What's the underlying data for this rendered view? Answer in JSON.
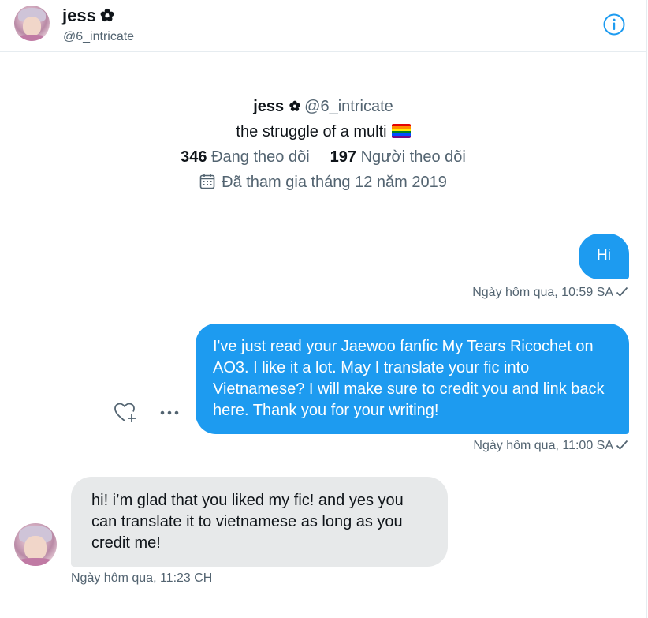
{
  "header": {
    "name": "jess",
    "handle": "@6_intricate"
  },
  "profile": {
    "name": "jess",
    "handle": "@6_intricate",
    "bio": "the struggle of a multi",
    "following_count": "346",
    "following_label": "Đang theo dõi",
    "followers_count": "197",
    "followers_label": "Người theo dõi",
    "joined": "Đã tham gia tháng 12 năm 2019"
  },
  "messages": [
    {
      "direction": "sent",
      "text": "Hi",
      "time": "Ngày hôm qua, 10:59 SA"
    },
    {
      "direction": "sent",
      "text": "I've just read your Jaewoo fanfic My Tears Ricochet on AO3. I like it a lot. May I translate your fic into Vietnamese? I will make sure to credit you and link back here. Thank you for your writing!",
      "time": "Ngày hôm qua, 11:00 SA"
    },
    {
      "direction": "received",
      "text": "hi! i’m glad that you liked my fic! and yes you can translate it to vietnamese as long as you credit me!",
      "time": "Ngày hôm qua, 11:23 CH"
    }
  ],
  "colors": {
    "accent": "#1d9bf0",
    "received_bubble": "#e7e9ea",
    "secondary_text": "#536471"
  },
  "icons": [
    "info-icon",
    "flower-badge-icon",
    "calendar-icon",
    "heart-plus-icon",
    "more-icon",
    "check-icon",
    "rainbow-flag-emoji"
  ]
}
